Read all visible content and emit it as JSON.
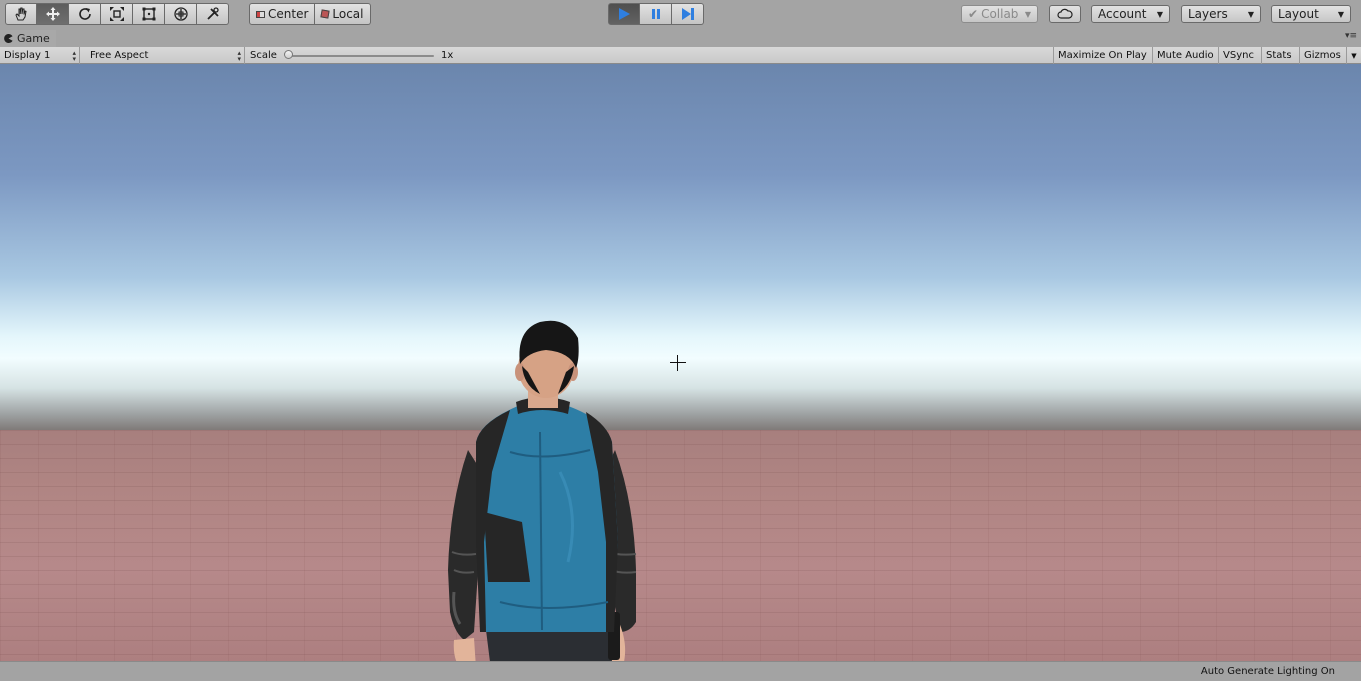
{
  "toolbar": {
    "tools": [
      {
        "name": "hand-tool",
        "icon": "hand-icon"
      },
      {
        "name": "move-tool",
        "icon": "move-arrows-icon"
      },
      {
        "name": "rotate-tool",
        "icon": "rotate-icon"
      },
      {
        "name": "scale-tool",
        "icon": "scale-icon"
      },
      {
        "name": "rect-tool",
        "icon": "rect-transform-icon"
      },
      {
        "name": "transform-tool",
        "icon": "transform-icon"
      },
      {
        "name": "custom-tool",
        "icon": "custom-tools-icon"
      }
    ],
    "active_tool": "move-tool",
    "pivot_label": "Center",
    "space_label": "Local",
    "play_icon": "play-icon",
    "pause_icon": "pause-icon",
    "step_icon": "step-icon",
    "collab_label": "Collab",
    "cloud_icon": "cloud-icon",
    "account_label": "Account",
    "layers_label": "Layers",
    "layout_label": "Layout"
  },
  "tab": {
    "title": "Game",
    "icon": "game-pacman-icon"
  },
  "game_bar": {
    "display_label": "Display 1",
    "aspect_label": "Free Aspect",
    "scale_label": "Scale",
    "scale_value": "1x",
    "scale_fraction": 0.0,
    "maximize_label": "Maximize On Play",
    "mute_label": "Mute Audio",
    "vsync_label": "VSync",
    "stats_label": "Stats",
    "gizmos_label": "Gizmos"
  },
  "status": {
    "text": "Auto Generate Lighting On"
  },
  "colors": {
    "play_accent": "#2f7fe0",
    "jacket": "#2d7ea6",
    "leather": "#2a2a2a",
    "floor": "#b08583",
    "sky_top": "#6b86ad"
  }
}
